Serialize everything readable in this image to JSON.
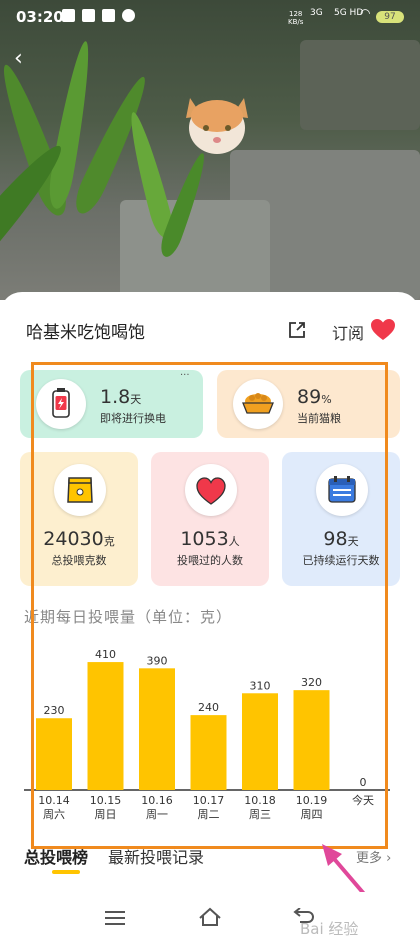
{
  "status_bar": {
    "time": "03:20",
    "net_speed_value": "128",
    "net_speed_unit": "KB/s",
    "sig1": "3G",
    "sig2": "5G HD",
    "battery": "97"
  },
  "header": {
    "device_name": "哈基米吃饱喝饱",
    "subscribe_label": "订阅",
    "heart_color": "#f0384a"
  },
  "stats": {
    "battery": {
      "value": "1.8",
      "unit": "天",
      "caption": "即将进行换电",
      "color": "#c9f0e0"
    },
    "food": {
      "value": "89",
      "unit": "%",
      "caption": "当前猫粮",
      "color": "#fde8cf"
    },
    "total_feed": {
      "value": "24030",
      "unit": "克",
      "caption": "总投喂克数",
      "color": "#fdefcf"
    },
    "people": {
      "value": "1053",
      "unit": "人",
      "caption": "投喂过的人数",
      "color": "#fde3e3"
    },
    "days": {
      "value": "98",
      "unit": "天",
      "caption": "已持续运行天数",
      "color": "#e0ebfb"
    }
  },
  "chart_title": "近期每日投喂量（单位：克）",
  "chart_data": {
    "type": "bar",
    "categories": [
      "10.14",
      "10.15",
      "10.16",
      "10.17",
      "10.18",
      "10.19",
      "今天"
    ],
    "weekdays": [
      "周六",
      "周日",
      "周一",
      "周二",
      "周三",
      "周四",
      ""
    ],
    "values": [
      230,
      410,
      390,
      240,
      310,
      320,
      0
    ],
    "bar_color": "#ffc400",
    "title": "近期每日投喂量（单位：克）",
    "ylim": [
      0,
      450
    ]
  },
  "tabs": {
    "tab1": "总投喂榜",
    "tab2": "最新投喂记录",
    "more": "更多"
  },
  "watermark": "Bai 经验"
}
